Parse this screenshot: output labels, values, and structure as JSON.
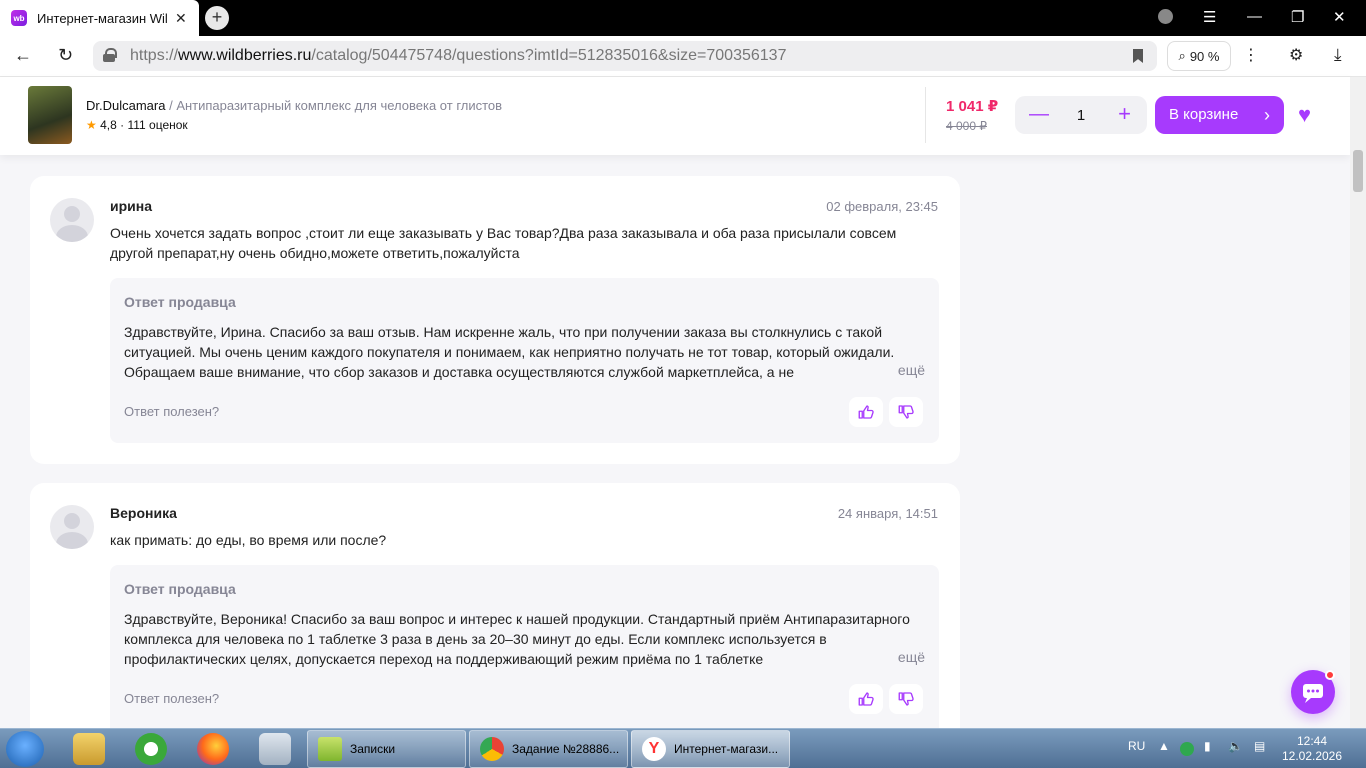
{
  "browser": {
    "tab_title": "Интернет-магазин Wil",
    "tab_favicon": "wb",
    "url_prefix": "https://",
    "url_domain": "www.wildberries.ru",
    "url_path": "/catalog/504475748/questions?imtId=512835016&size=700356137",
    "zoom": "90 %"
  },
  "product": {
    "brand": "Dr.Dulcamara",
    "separator": " / ",
    "name": "Антипаразитарный комплекс для человека от глистов",
    "rating": "4,8",
    "reviews": "111 оценок",
    "price": "1 041 ₽",
    "old_price": "4 000 ₽",
    "quantity": "1",
    "cart_label": "В корзине"
  },
  "questions": [
    {
      "author": "ирина",
      "date": "02 февраля, 23:45",
      "text": "Очень хочется задать вопрос ,стоит ли еще заказывать у Вас товар?Два раза заказывала и оба раза присылали совсем другой препарат,ну очень обидно,можете ответить,пожалуйста",
      "answer_title": "Ответ продавца",
      "answer_text": "Здравствуйте, Ирина. Спасибо за ваш отзыв. Нам искренне жаль, что при получении заказа вы столкнулись с такой ситуацией. Мы очень ценим каждого покупателя и понимаем, как неприятно получать не тот товар, который ожидали. Обращаем ваше внимание, что сбор заказов и доставка осуществляются службой маркетплейса, а не",
      "more": "ещё",
      "helpful": "Ответ полезен?"
    },
    {
      "author": "Вероника",
      "date": "24 января, 14:51",
      "text": "как примать: до еды, во время или после?",
      "answer_title": "Ответ продавца",
      "answer_text": "Здравствуйте, Вероника! Спасибо за ваш вопрос и интерес к нашей продукции. Стандартный приём Антипаразитарного комплекса для человека по 1 таблетке 3 раза в день за 20–30 минут до еды. Если комплекс используется в профилактических целях, допускается переход на поддерживающий режим приёма по 1 таблетке",
      "more": "ещё",
      "helpful": "Ответ полезен?"
    }
  ],
  "taskbar": {
    "tasks": [
      "Записки",
      "Задание №28886...",
      "Интернет-магази..."
    ],
    "lang": "RU",
    "time": "12:44",
    "date": "12.02.2026"
  },
  "colors": {
    "accent": "#a73afd",
    "price": "#f0286a"
  }
}
